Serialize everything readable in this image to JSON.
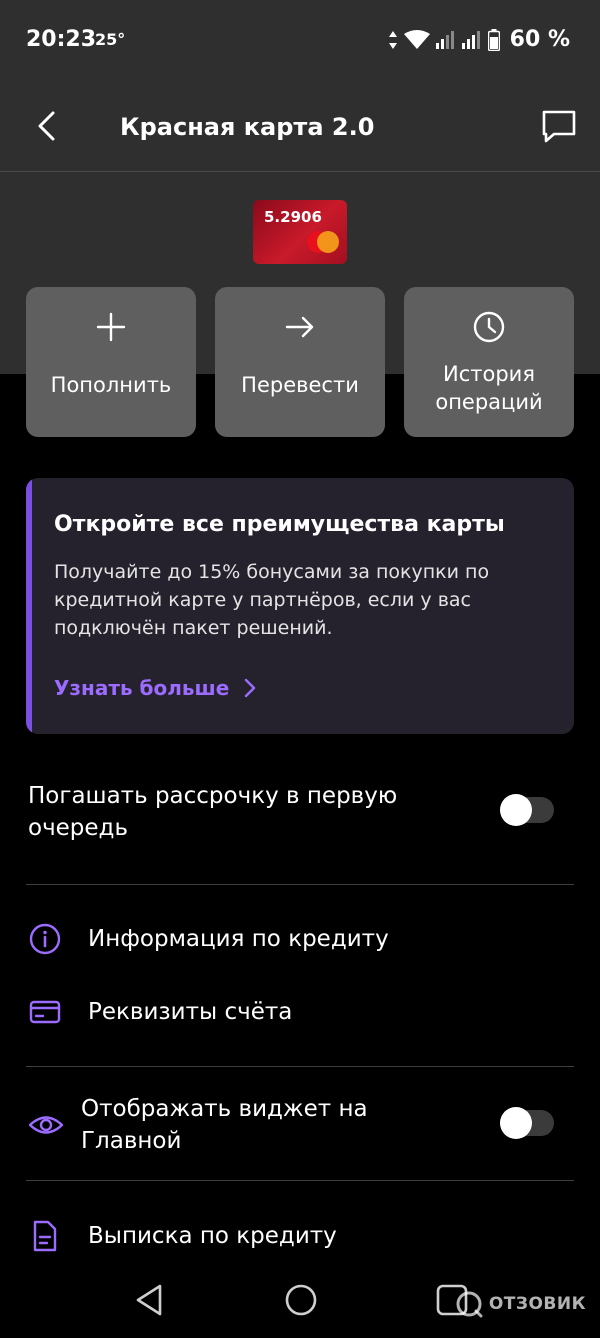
{
  "status_bar": {
    "time": "20:23",
    "temperature": "25°",
    "battery": "60 %"
  },
  "header": {
    "title": "Красная карта 2.0"
  },
  "card": {
    "number_short": "5.2906"
  },
  "actions": [
    {
      "label": "Пополнить"
    },
    {
      "label": "Перевести"
    },
    {
      "label_line1": "История",
      "label_line2": "операций"
    }
  ],
  "promo": {
    "title": "Откройте все преимущества карты",
    "text": "Получайте до 15% бонусами за покупки по кредитной карте у партнёров, если у вас подключён пакет решений.",
    "link": "Узнать больше"
  },
  "settings": {
    "installment_first": {
      "label": "Погашать рассрочку в первую очередь",
      "enabled": false
    },
    "show_widget": {
      "label": "Отображать виджет на Главной",
      "enabled": false
    }
  },
  "menu": {
    "credit_info": "Информация по кредиту",
    "account_details": "Реквизиты счёта",
    "credit_statement": "Выписка по кредиту"
  },
  "watermark": "ОТЗОВИК",
  "colors": {
    "accent": "#9c6bff",
    "background": "#000000",
    "header_bg": "#2f2f2f",
    "action_bg": "#5f5f5f",
    "promo_bg": "#25222d",
    "card_red": "#c81a2a"
  }
}
